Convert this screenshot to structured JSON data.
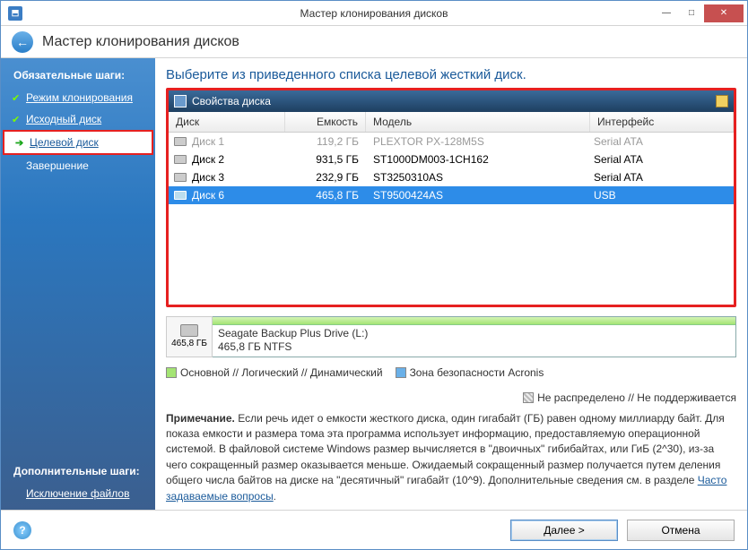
{
  "titlebar": {
    "title": "Мастер клонирования дисков"
  },
  "wizard": {
    "title": "Мастер клонирования дисков"
  },
  "sidebar": {
    "required_heading": "Обязательные шаги:",
    "optional_heading": "Дополнительные шаги:",
    "steps": [
      {
        "label": "Режим клонирования"
      },
      {
        "label": "Исходный диск"
      },
      {
        "label": "Целевой диск"
      },
      {
        "label": "Завершение"
      }
    ],
    "optional_steps": [
      {
        "label": "Исключение файлов"
      }
    ]
  },
  "instruction": "Выберите из приведенного списка целевой жесткий диск.",
  "panel_title": "Свойства диска",
  "columns": {
    "disk": "Диск",
    "cap": "Емкость",
    "model": "Модель",
    "iface": "Интерфейс"
  },
  "disks": [
    {
      "name": "Диск 1",
      "cap": "119,2 ГБ",
      "model": "PLEXTOR PX-128M5S",
      "iface": "Serial ATA",
      "state": "disabled"
    },
    {
      "name": "Диск 2",
      "cap": "931,5 ГБ",
      "model": "ST1000DM003-1CH162",
      "iface": "Serial ATA",
      "state": "normal"
    },
    {
      "name": "Диск 3",
      "cap": "232,9 ГБ",
      "model": "ST3250310AS",
      "iface": "Serial ATA",
      "state": "normal"
    },
    {
      "name": "Диск 6",
      "cap": "465,8 ГБ",
      "model": "ST9500424AS",
      "iface": "USB",
      "state": "selected"
    }
  ],
  "disk_visual": {
    "size_label": "465,8 ГБ",
    "line1": "Seagate Backup Plus Drive (L:)",
    "line2": "465,8 ГБ  NTFS"
  },
  "legend": {
    "primary": "Основной // Логический // Динамический",
    "acronis": "Зона безопасности Acronis",
    "unalloc": "Не распределено // Не поддерживается"
  },
  "note": {
    "bold": "Примечание.",
    "text": " Если речь идет о емкости жесткого диска, один гигабайт (ГБ) равен одному миллиарду байт. Для показа емкости и размера тома эта программа использует информацию, предоставляемую операционной системой. В файловой системе Windows размер вычисляется в \"двоичных\" гибибайтах, или ГиБ (2^30), из-за чего сокращенный размер оказывается меньше. Ожидаемый сокращенный размер получается путем деления общего числа байтов на диске на \"десятичный\" гигабайт (10^9). Дополнительные сведения см. в разделе ",
    "link": "Часто задаваемые вопросы"
  },
  "footer": {
    "next": "Далее >",
    "cancel": "Отмена"
  }
}
